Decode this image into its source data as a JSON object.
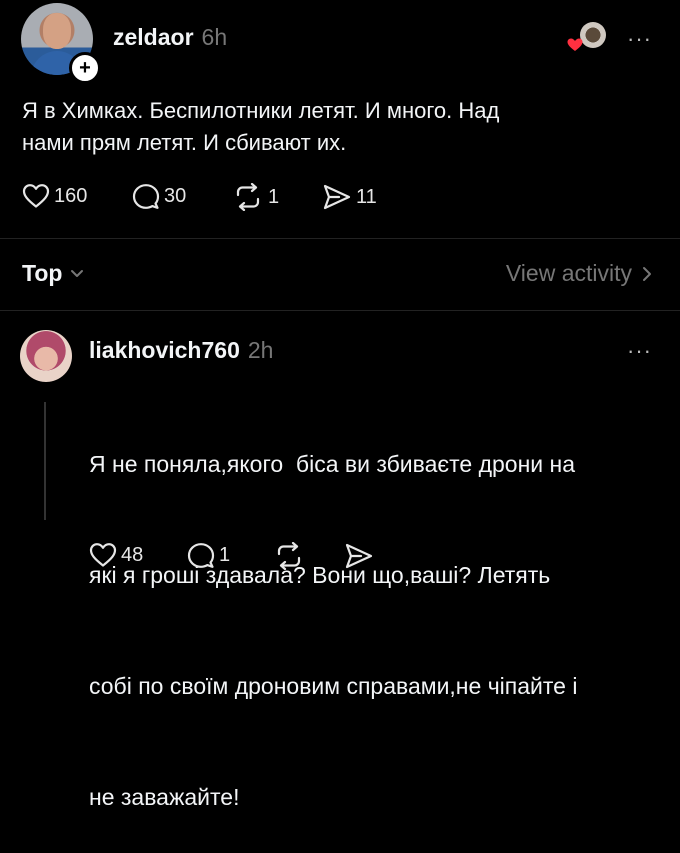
{
  "post": {
    "username": "zeldaor",
    "time": "6h",
    "follow_symbol": "+",
    "more": "···",
    "text_line1": "Я в Химках. Беспилотники летят. И много. Над",
    "text_line2": "нами прям летят. И сбивают их.",
    "actions": {
      "likes": "160",
      "comments": "30",
      "reposts": "1",
      "shares": "11"
    }
  },
  "sort": {
    "label": "Top",
    "view_activity": "View activity"
  },
  "comment": {
    "username": "liakhovich760",
    "time": "2h",
    "more": "···",
    "text_line1": "Я не поняла,якого  біса ви збиваєте дрони на",
    "text_line2": "які я гроші здавала? Вони що,ваші? Летять",
    "text_line3": "собі по своїм дроновим справами,не чіпайте і",
    "text_line4": "не заважайте!",
    "actions": {
      "likes": "48",
      "comments": "1"
    }
  },
  "colors": {
    "background": "#000000",
    "text": "#f3f5f7",
    "muted": "#777777",
    "like_badge": "#ff3040"
  },
  "icons": [
    "heart-icon",
    "comment-icon",
    "repost-icon",
    "share-icon",
    "chevron-down-icon",
    "chevron-right-icon",
    "more-icon",
    "plus-icon"
  ]
}
